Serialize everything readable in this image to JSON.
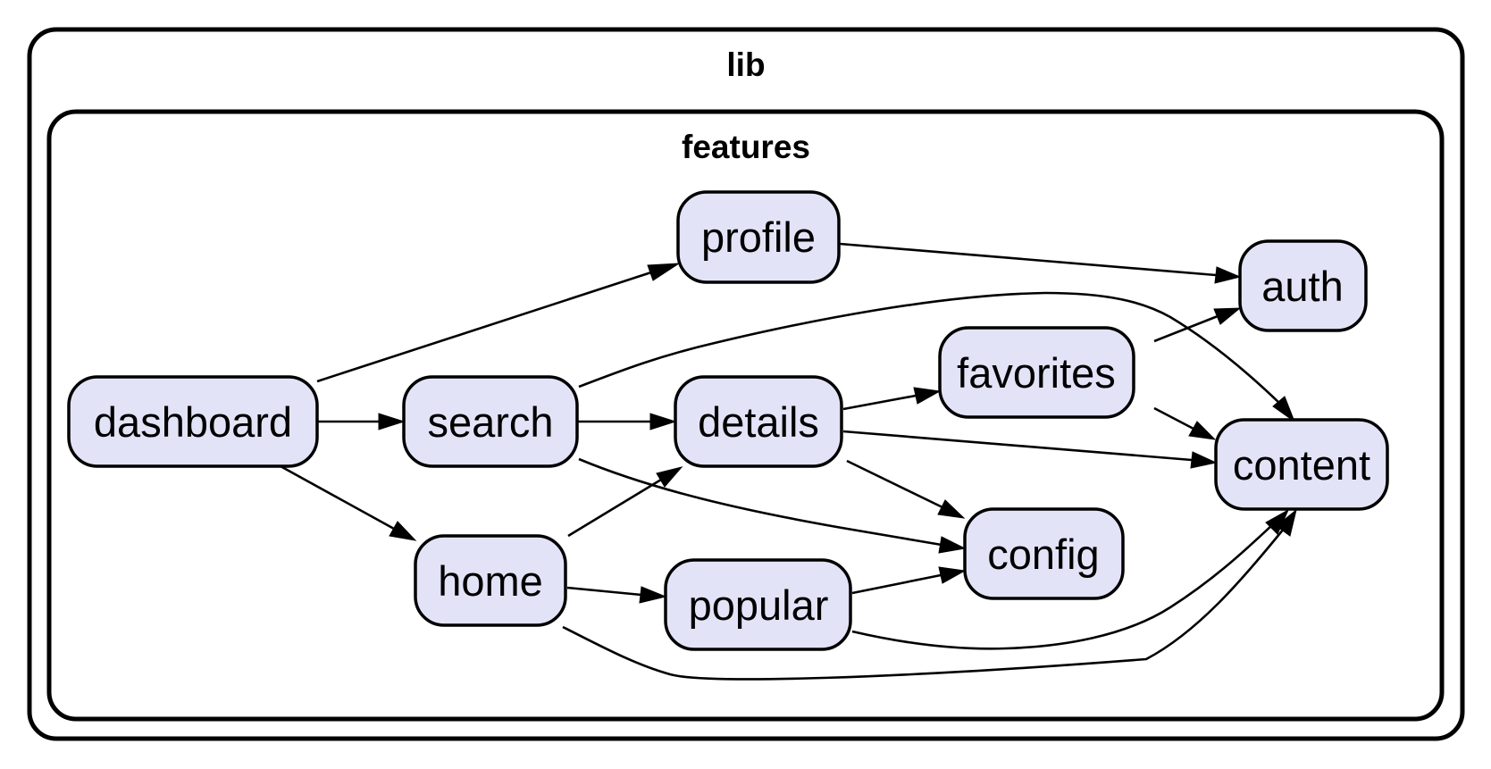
{
  "diagram": {
    "type": "dependency-graph",
    "clusters": [
      {
        "id": "lib",
        "label": "lib"
      },
      {
        "id": "features",
        "label": "features",
        "parent": "lib"
      }
    ],
    "nodes": [
      {
        "id": "dashboard",
        "label": "dashboard"
      },
      {
        "id": "search",
        "label": "search"
      },
      {
        "id": "profile",
        "label": "profile"
      },
      {
        "id": "details",
        "label": "details"
      },
      {
        "id": "home",
        "label": "home"
      },
      {
        "id": "popular",
        "label": "popular"
      },
      {
        "id": "favorites",
        "label": "favorites"
      },
      {
        "id": "config",
        "label": "config"
      },
      {
        "id": "auth",
        "label": "auth"
      },
      {
        "id": "content",
        "label": "content"
      }
    ],
    "edges": [
      {
        "from": "dashboard",
        "to": "profile"
      },
      {
        "from": "dashboard",
        "to": "search"
      },
      {
        "from": "dashboard",
        "to": "home"
      },
      {
        "from": "search",
        "to": "details"
      },
      {
        "from": "search",
        "to": "content"
      },
      {
        "from": "search",
        "to": "config"
      },
      {
        "from": "profile",
        "to": "auth"
      },
      {
        "from": "details",
        "to": "favorites"
      },
      {
        "from": "details",
        "to": "content"
      },
      {
        "from": "details",
        "to": "config"
      },
      {
        "from": "home",
        "to": "details"
      },
      {
        "from": "home",
        "to": "popular"
      },
      {
        "from": "home",
        "to": "content"
      },
      {
        "from": "popular",
        "to": "config"
      },
      {
        "from": "popular",
        "to": "content"
      },
      {
        "from": "favorites",
        "to": "auth"
      },
      {
        "from": "favorites",
        "to": "content"
      }
    ],
    "colors": {
      "node_fill": "#e3e3f8",
      "stroke": "#000000"
    }
  }
}
